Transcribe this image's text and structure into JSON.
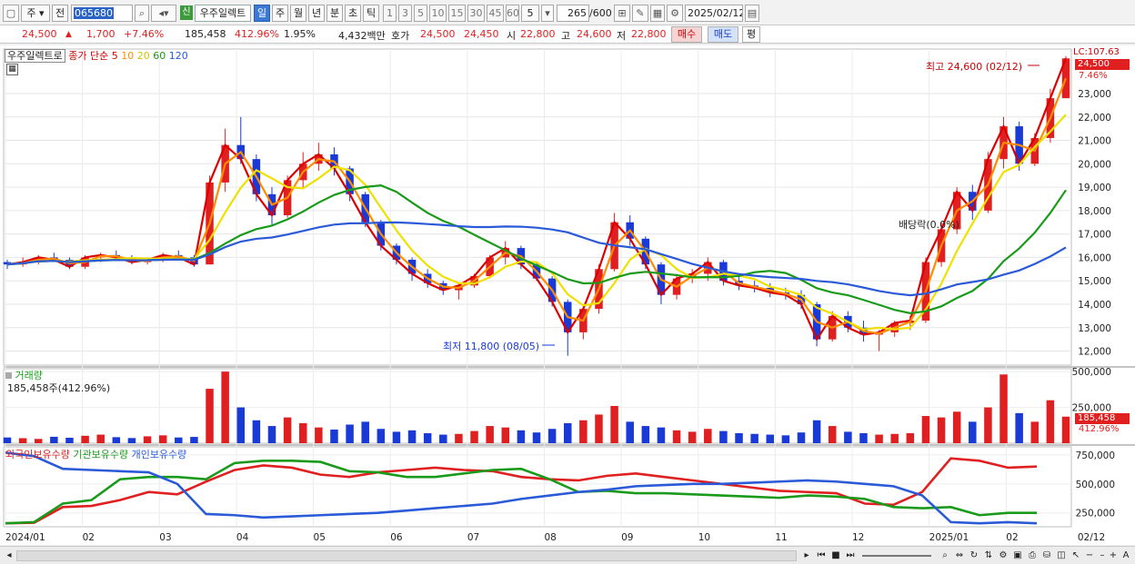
{
  "toolbar": {
    "period_label": "주",
    "prev_label": "전",
    "code_value": "065680",
    "stock_name": "우주일렉트",
    "new_badge": "신",
    "periods": [
      "일",
      "주",
      "월",
      "년",
      "분",
      "초",
      "틱"
    ],
    "intervals": [
      "1",
      "3",
      "5",
      "10",
      "15",
      "30",
      "45",
      "60"
    ],
    "custom_interval": "5",
    "count_value": "265",
    "count_total": "/600",
    "date_value": "2025/02/12"
  },
  "quote": {
    "price": "24,500",
    "change": "1,700",
    "change_rate": "+7.46%",
    "volume": "185,458",
    "volume_rate": "412.96%",
    "turnover_rate": "1.95%",
    "amount": "4,432백만",
    "ask_label": "호가",
    "ask": "24,500",
    "bid": "24,450",
    "open_label": "시",
    "open": "22,800",
    "high_label": "고",
    "high": "24,600",
    "low_label": "저",
    "low": "22,800",
    "buy_label": "매수",
    "sell_label": "매도",
    "avg_label": "평"
  },
  "panels": {
    "price": {
      "name": "우주일렉트로",
      "price_type": "종가",
      "ma_type": "단순",
      "ma_labels": [
        "5",
        "10",
        "20",
        "60",
        "120"
      ],
      "high_annot": "최고 24,600 (02/12)",
      "low_annot": "최저 11,800 (08/05)",
      "dividend_annot": "배당락(0.0%)",
      "lc_label": "LC:107.63",
      "cur_price": "24,500",
      "cur_rate": "7.46%"
    },
    "volume": {
      "title": "거래량",
      "sub": "185,458주(412.96%)",
      "cur": "185,458",
      "cur_rate": "412.96%"
    },
    "holdings": {
      "series": [
        "외국인보유수량",
        "기관보유수량",
        "개인보유수량"
      ]
    }
  },
  "colors": {
    "ma5": "#dd0000",
    "ma10": "#ff8c00",
    "ma20": "#f0e000",
    "ma60": "#1a9a1a",
    "ma120": "#2a5ad8",
    "up": "#e02020",
    "down": "#1a3ad8"
  },
  "chart_data": [
    {
      "type": "candlestick",
      "title": "",
      "y_ticks": [
        "12,000",
        "13,000",
        "14,000",
        "15,000",
        "16,000",
        "17,000",
        "18,000",
        "19,000",
        "20,000",
        "21,000",
        "22,000",
        "23,000"
      ],
      "ylim": [
        11400,
        24900
      ],
      "x": [
        "2024/01",
        "02",
        "03",
        "04",
        "05",
        "06",
        "07",
        "08",
        "09",
        "10",
        "11",
        "12",
        "2025/01",
        "02",
        "02/12"
      ],
      "ohlc_weekly": [
        [
          15800,
          15900,
          15500,
          15700
        ],
        [
          15700,
          16000,
          15600,
          15800
        ],
        [
          15800,
          16100,
          15700,
          16000
        ],
        [
          16000,
          16200,
          15800,
          15900
        ],
        [
          15900,
          16000,
          15500,
          15600
        ],
        [
          15600,
          16100,
          15500,
          16000
        ],
        [
          16000,
          16200,
          15800,
          16100
        ],
        [
          16100,
          16300,
          15900,
          16000
        ],
        [
          16000,
          16100,
          15700,
          15800
        ],
        [
          15800,
          16000,
          15700,
          15900
        ],
        [
          15900,
          16200,
          15800,
          16100
        ],
        [
          16100,
          16300,
          15900,
          16000
        ],
        [
          16000,
          16100,
          15600,
          15700
        ],
        [
          15700,
          19500,
          15700,
          19200
        ],
        [
          19200,
          21500,
          18800,
          20800
        ],
        [
          20800,
          22000,
          20000,
          20200
        ],
        [
          20200,
          20400,
          18400,
          18700
        ],
        [
          18700,
          19000,
          17400,
          17800
        ],
        [
          17800,
          19500,
          17700,
          19300
        ],
        [
          19300,
          20500,
          19000,
          20000
        ],
        [
          20000,
          20900,
          19700,
          20400
        ],
        [
          20400,
          20700,
          19500,
          19800
        ],
        [
          19800,
          19900,
          18400,
          18700
        ],
        [
          18700,
          18800,
          17300,
          17500
        ],
        [
          17500,
          17600,
          16300,
          16500
        ],
        [
          16500,
          16600,
          15700,
          15900
        ],
        [
          15900,
          16000,
          15000,
          15300
        ],
        [
          15300,
          15500,
          14700,
          14900
        ],
        [
          14900,
          15000,
          14400,
          14600
        ],
        [
          14600,
          14900,
          14200,
          14800
        ],
        [
          14800,
          15300,
          14700,
          15200
        ],
        [
          15200,
          16100,
          15100,
          16000
        ],
        [
          16000,
          16700,
          15700,
          16400
        ],
        [
          16400,
          16500,
          15500,
          15700
        ],
        [
          15700,
          15800,
          15000,
          15100
        ],
        [
          15100,
          15200,
          13900,
          14100
        ],
        [
          14100,
          14200,
          11800,
          12800
        ],
        [
          12800,
          14000,
          12500,
          13800
        ],
        [
          13800,
          15700,
          13600,
          15500
        ],
        [
          15500,
          17900,
          15400,
          17500
        ],
        [
          17500,
          17800,
          16500,
          16800
        ],
        [
          16800,
          16900,
          15500,
          15700
        ],
        [
          15700,
          15800,
          14000,
          14400
        ],
        [
          14400,
          15300,
          14200,
          15100
        ],
        [
          15100,
          15500,
          14900,
          15300
        ],
        [
          15300,
          16000,
          15000,
          15800
        ],
        [
          15800,
          15900,
          14800,
          15000
        ],
        [
          15000,
          15200,
          14600,
          14800
        ],
        [
          14800,
          15000,
          14500,
          14700
        ],
        [
          14700,
          14900,
          14300,
          14500
        ],
        [
          14500,
          14700,
          14200,
          14400
        ],
        [
          14400,
          14600,
          13800,
          14000
        ],
        [
          14000,
          14100,
          12200,
          12500
        ],
        [
          12500,
          13700,
          12400,
          13500
        ],
        [
          13500,
          13700,
          12800,
          13000
        ],
        [
          13000,
          13300,
          12400,
          12700
        ],
        [
          12700,
          12900,
          12000,
          12800
        ],
        [
          12800,
          13300,
          12600,
          13200
        ],
        [
          13200,
          13500,
          12900,
          13300
        ],
        [
          13300,
          16000,
          13200,
          15800
        ],
        [
          15800,
          17500,
          15600,
          17200
        ],
        [
          17200,
          19000,
          17000,
          18800
        ],
        [
          18800,
          19100,
          17600,
          18000
        ],
        [
          18000,
          20500,
          17900,
          20200
        ],
        [
          20200,
          22000,
          19800,
          21600
        ],
        [
          21600,
          21800,
          19700,
          20000
        ],
        [
          20000,
          21300,
          19900,
          21100
        ],
        [
          21100,
          23200,
          20900,
          22800
        ],
        [
          22800,
          24600,
          22800,
          24500
        ]
      ]
    },
    {
      "type": "bar",
      "title": "거래량",
      "y_ticks": [
        "250,000",
        "500,000"
      ],
      "ylim": [
        0,
        520000
      ],
      "values": [
        40000,
        35000,
        30000,
        45000,
        38000,
        52000,
        60000,
        42000,
        36000,
        48000,
        55000,
        40000,
        44000,
        380000,
        500000,
        250000,
        160000,
        120000,
        180000,
        140000,
        110000,
        95000,
        130000,
        150000,
        100000,
        80000,
        90000,
        70000,
        60000,
        65000,
        85000,
        120000,
        110000,
        90000,
        75000,
        100000,
        140000,
        160000,
        200000,
        260000,
        150000,
        120000,
        110000,
        90000,
        80000,
        100000,
        85000,
        70000,
        65000,
        60000,
        55000,
        75000,
        160000,
        120000,
        80000,
        70000,
        60000,
        65000,
        70000,
        190000,
        180000,
        220000,
        150000,
        250000,
        480000,
        210000,
        150000,
        300000,
        185458
      ]
    },
    {
      "type": "line",
      "title": "",
      "y_ticks": [
        "250,000",
        "500,000",
        "750,000"
      ],
      "ylim": [
        130000,
        820000
      ],
      "series": [
        {
          "name": "외국인보유수량",
          "values": [
            160000,
            165000,
            300000,
            310000,
            360000,
            430000,
            410000,
            520000,
            620000,
            660000,
            640000,
            580000,
            560000,
            600000,
            620000,
            640000,
            620000,
            610000,
            560000,
            540000,
            530000,
            570000,
            590000,
            560000,
            530000,
            500000,
            470000,
            440000,
            430000,
            420000,
            330000,
            320000,
            430000,
            720000,
            700000,
            640000,
            650000
          ]
        },
        {
          "name": "기관보유수량",
          "values": [
            160000,
            170000,
            330000,
            360000,
            540000,
            560000,
            560000,
            540000,
            680000,
            700000,
            700000,
            690000,
            610000,
            600000,
            560000,
            560000,
            590000,
            620000,
            630000,
            540000,
            430000,
            440000,
            420000,
            420000,
            410000,
            400000,
            390000,
            380000,
            400000,
            390000,
            370000,
            300000,
            290000,
            300000,
            230000,
            250000,
            250000
          ]
        },
        {
          "name": "개인보유수량",
          "values": [
            770000,
            740000,
            630000,
            620000,
            610000,
            600000,
            500000,
            240000,
            230000,
            210000,
            220000,
            230000,
            240000,
            250000,
            270000,
            290000,
            310000,
            330000,
            370000,
            400000,
            430000,
            450000,
            480000,
            490000,
            500000,
            500000,
            510000,
            520000,
            530000,
            520000,
            500000,
            480000,
            400000,
            170000,
            160000,
            170000,
            160000
          ]
        }
      ]
    }
  ]
}
